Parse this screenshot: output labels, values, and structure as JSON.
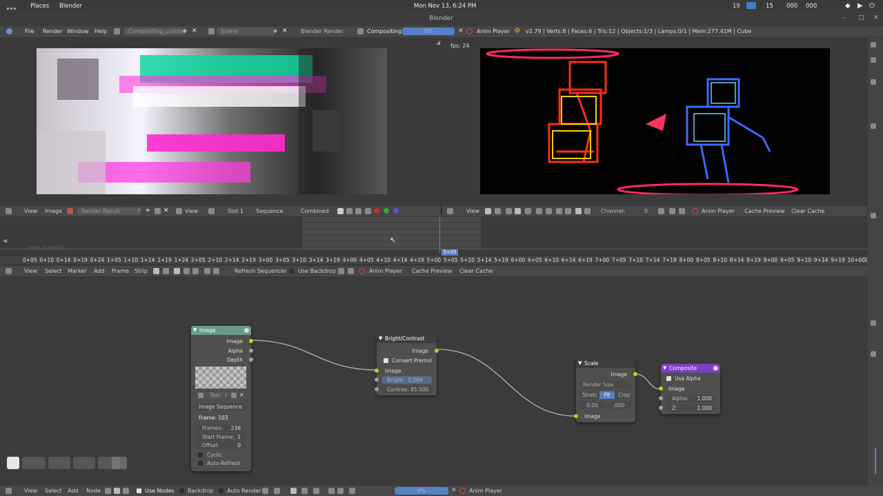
{
  "os_bar": {
    "activities": "Places",
    "app": "Blender",
    "clock": "Mon Nov 13,  6:24 PM",
    "cpu": "19",
    "net1": "15",
    "mem1": "000",
    "mem2": "000"
  },
  "window_title": "Blender",
  "info": {
    "menus": [
      "File",
      "Render",
      "Window",
      "Help"
    ],
    "screen_layout": "Compositing_custom",
    "scene": "Scene",
    "engine": "Blender Render",
    "mode": "Compositing",
    "progress": "0%",
    "progress_value": 0,
    "anim_player": "Anim Player",
    "stats": "v2.79 | Verts:8 | Faces:6 | Tris:12 | Objects:1/3 | Lamps:0/1 | Mem:277.41M | Cube"
  },
  "image_editor": {
    "view": "View",
    "image": "Image",
    "image_name": "Render Result",
    "f_label": "F",
    "view2": "View",
    "slot": "Slot 1",
    "layer": "Sequence",
    "pass": "Combined"
  },
  "sequencer_preview": {
    "fps": "fps: 24",
    "view": "View",
    "channel_label": "Channel:",
    "channel_value": "0",
    "anim_player": "Anim Player",
    "cache_preview": "Cache Preview",
    "clear_cache": "Clear Cache"
  },
  "timeline": {
    "strip_label": "Scene: Scene.001",
    "current_frame": "5+05",
    "ruler": [
      "0+05",
      "0+10",
      "0+14",
      "0+19",
      "0+24",
      "1+05",
      "1+10",
      "1+14",
      "1+19",
      "1+24",
      "2+05",
      "2+10",
      "2+14",
      "2+19",
      "3+00",
      "3+05",
      "3+10",
      "3+14",
      "3+19",
      "4+00",
      "4+05",
      "4+10",
      "4+14",
      "4+19",
      "5+00",
      "5+05",
      "5+10",
      "5+14",
      "5+19",
      "6+00",
      "6+05",
      "6+10",
      "6+14",
      "6+19",
      "7+00",
      "7+05",
      "7+10",
      "7+14",
      "7+19",
      "8+00",
      "8+05",
      "8+10",
      "8+14",
      "8+19",
      "9+00",
      "9+05",
      "9+10",
      "9+14",
      "9+19",
      "10+00",
      "10+05"
    ]
  },
  "seq_header": {
    "view": "View",
    "select": "Select",
    "marker": "Marker",
    "add": "Add",
    "frame": "Frame",
    "strip": "Strip",
    "refresh": "Refresh Sequencer",
    "use_backdrop": "Use Backdrop",
    "anim_player": "Anim Player",
    "cache_preview": "Cache Preview",
    "clear_cache": "Clear Cache"
  },
  "nodes": {
    "image": {
      "title": "Image",
      "out_image": "Image",
      "out_alpha": "Alpha",
      "out_depth": "Depth",
      "tear": "Tear",
      "f": "F",
      "source": "Image Sequence",
      "frame": "Frame: 103",
      "frames_label": "Frames:",
      "frames_value": "236",
      "start_label": "Start Frame:",
      "start_value": "1",
      "offset_label": "Offset:",
      "offset_value": "0",
      "cyclic": "Cyclic",
      "auto_refresh": "Auto-Refresh"
    },
    "bright": {
      "title": "Bright/Contrast",
      "out_image": "Image",
      "convert_premul": "Convert Premul",
      "in_image": "Image",
      "bright": "Bright: -5.569",
      "contrast": "Contras: 85.500"
    },
    "scale": {
      "title": "Scale",
      "out_image": "Image",
      "render_size": "Render Size",
      "stretch": "Stretc",
      "fit": "Fit",
      "crop": "Crop",
      "x": "0.00",
      "y": ".000",
      "in_image": "Image"
    },
    "composite": {
      "title": "Composite",
      "use_alpha": "Use Alpha",
      "in_image": "Image",
      "alpha": "Alpha:",
      "alpha_value": "1.000",
      "z": "Z:",
      "z_value": "1.000"
    }
  },
  "node_header": {
    "view": "View",
    "select": "Select",
    "add": "Add",
    "node": "Node",
    "use_nodes": "Use Nodes",
    "backdrop": "Backdrop",
    "auto_render": "Auto Render",
    "progress": "0%",
    "anim_player": "Anim Player"
  },
  "colors": {
    "accent_blue": "#5680c2",
    "image_node": "#6a9b8a",
    "composite_node": "#7b3fc2",
    "socket_yellow": "#c7c729",
    "red_button": "#e34b4b"
  }
}
